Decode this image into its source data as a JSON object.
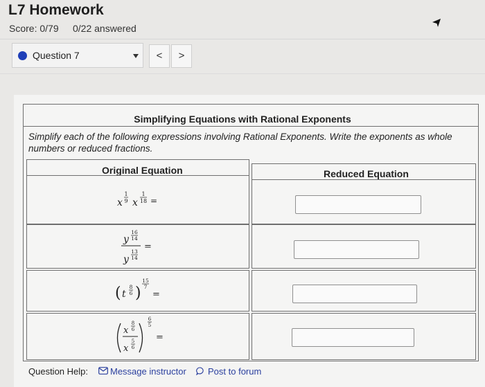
{
  "header": {
    "title": "L7 Homework",
    "score": "Score: 0/79",
    "answered": "0/22 answered"
  },
  "question_selector": {
    "label": "Question 7",
    "prev_label": "<",
    "next_label": ">"
  },
  "table": {
    "title": "Simplifying Equations with Rational Exponents",
    "instructions": "Simplify each of the following expressions involving Rational Exponents. Write the exponents as whole numbers or reduced fractions.",
    "col_original": "Original Equation",
    "col_reduced": "Reduced Equation"
  },
  "equations": [
    {
      "var1": "x",
      "n1": "1",
      "d1": "9",
      "var2": "x",
      "n2": "1",
      "d2": "18",
      "eq": "="
    },
    {
      "var": "y",
      "num_n": "16",
      "num_d": "14",
      "den_n": "13",
      "den_d": "14",
      "eq": "="
    },
    {
      "var": "t",
      "in_n": "8",
      "in_d": "6",
      "out_n": "15",
      "out_d": "7",
      "eq": "="
    },
    {
      "var": "x",
      "top_n": "8",
      "top_d": "6",
      "bot_n": "5",
      "bot_d": "6",
      "out_n": "6",
      "out_d": "5",
      "eq": "="
    }
  ],
  "answers": [
    "",
    "",
    "",
    ""
  ],
  "help": {
    "label": "Question Help:",
    "message": "Message instructor",
    "post": "Post to forum"
  },
  "colors": {
    "accent": "#1f3fb8",
    "link": "#2a3f9e"
  }
}
